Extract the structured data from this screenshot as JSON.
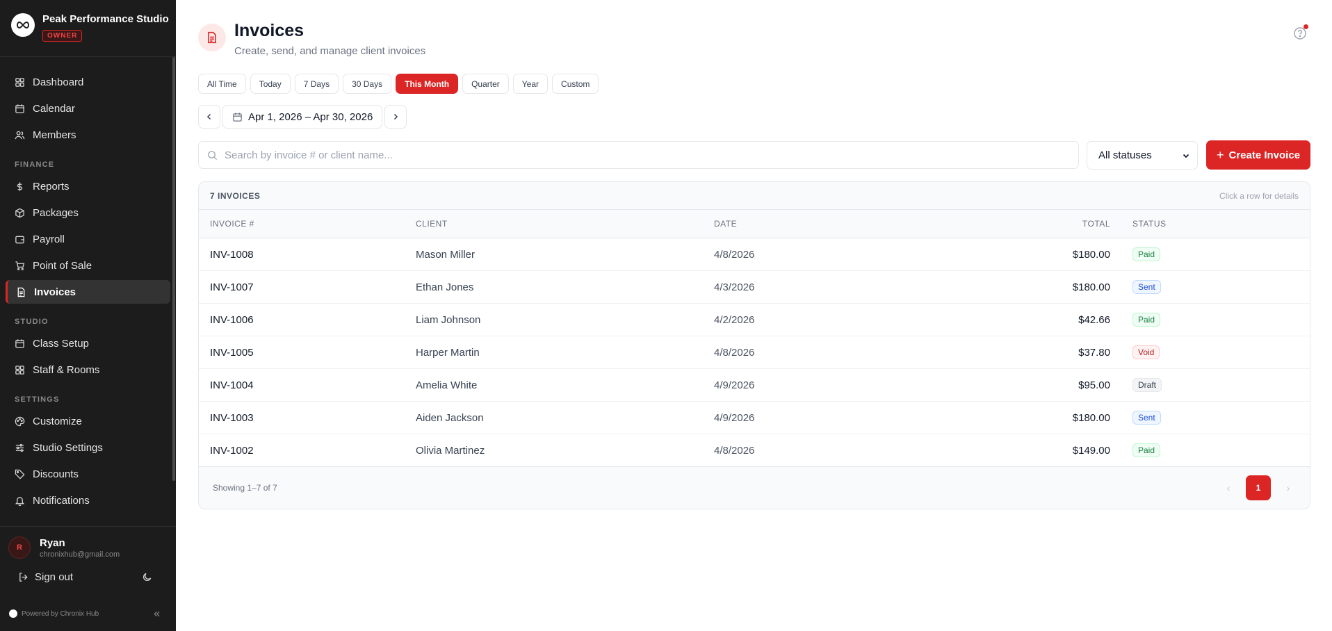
{
  "sidebar": {
    "studio_name": "Peak Performance Studio",
    "role_badge": "OWNER",
    "main_items": [
      {
        "label": "Dashboard",
        "icon": "dashboard-icon"
      },
      {
        "label": "Calendar",
        "icon": "calendar-icon"
      },
      {
        "label": "Members",
        "icon": "members-icon"
      }
    ],
    "finance_section": "FINANCE",
    "finance_items": [
      {
        "label": "Reports",
        "icon": "dollar-icon"
      },
      {
        "label": "Packages",
        "icon": "package-icon"
      },
      {
        "label": "Payroll",
        "icon": "wallet-icon"
      },
      {
        "label": "Point of Sale",
        "icon": "cart-icon"
      },
      {
        "label": "Invoices",
        "icon": "invoice-icon",
        "active": true
      }
    ],
    "studio_section": "STUDIO",
    "studio_items": [
      {
        "label": "Class Setup",
        "icon": "calendar-icon"
      },
      {
        "label": "Staff & Rooms",
        "icon": "grid-icon"
      }
    ],
    "settings_section": "SETTINGS",
    "settings_items": [
      {
        "label": "Customize",
        "icon": "palette-icon"
      },
      {
        "label": "Studio Settings",
        "icon": "sliders-icon"
      },
      {
        "label": "Discounts",
        "icon": "tag-icon"
      },
      {
        "label": "Notifications",
        "icon": "bell-icon"
      }
    ],
    "user": {
      "initial": "R",
      "name": "Ryan",
      "email": "chronixhub@gmail.com"
    },
    "sign_out": "Sign out",
    "powered_by": "Powered by Chronix Hub"
  },
  "header": {
    "title": "Invoices",
    "subtitle": "Create, send, and manage client invoices"
  },
  "range_tabs": [
    "All Time",
    "Today",
    "7 Days",
    "30 Days",
    "This Month",
    "Quarter",
    "Year",
    "Custom"
  ],
  "active_range": "This Month",
  "date_range": "Apr 1, 2026 – Apr 30, 2026",
  "search": {
    "placeholder": "Search by invoice # or client name...",
    "value": ""
  },
  "status_filter": {
    "selected": "All statuses"
  },
  "create_button": "Create Invoice",
  "table": {
    "count_label": "7 INVOICES",
    "hint": "Click a row for details",
    "columns": [
      "INVOICE #",
      "CLIENT",
      "DATE",
      "TOTAL",
      "STATUS"
    ],
    "rows": [
      {
        "invoice": "INV-1008",
        "client": "Mason Miller",
        "date": "4/8/2026",
        "total": "$180.00",
        "status": "Paid"
      },
      {
        "invoice": "INV-1007",
        "client": "Ethan Jones",
        "date": "4/3/2026",
        "total": "$180.00",
        "status": "Sent"
      },
      {
        "invoice": "INV-1006",
        "client": "Liam Johnson",
        "date": "4/2/2026",
        "total": "$42.66",
        "status": "Paid"
      },
      {
        "invoice": "INV-1005",
        "client": "Harper Martin",
        "date": "4/8/2026",
        "total": "$37.80",
        "status": "Void"
      },
      {
        "invoice": "INV-1004",
        "client": "Amelia White",
        "date": "4/9/2026",
        "total": "$95.00",
        "status": "Draft"
      },
      {
        "invoice": "INV-1003",
        "client": "Aiden Jackson",
        "date": "4/9/2026",
        "total": "$180.00",
        "status": "Sent"
      },
      {
        "invoice": "INV-1002",
        "client": "Olivia Martinez",
        "date": "4/8/2026",
        "total": "$149.00",
        "status": "Paid"
      }
    ],
    "showing": "Showing 1–7 of 7",
    "current_page": "1"
  },
  "status_colors": {
    "Paid": {
      "text": "#15803d",
      "bg": "#f0fdf4",
      "border": "#bbf7d0"
    },
    "Sent": {
      "text": "#1d4ed8",
      "bg": "#eff6ff",
      "border": "#bfdbfe"
    },
    "Void": {
      "text": "#b91c1c",
      "bg": "#fef2f2",
      "border": "#fecaca"
    },
    "Draft": {
      "text": "#374151",
      "bg": "#f3f4f6",
      "border": "#e5e7eb"
    }
  },
  "accent_color": "#dc2626"
}
